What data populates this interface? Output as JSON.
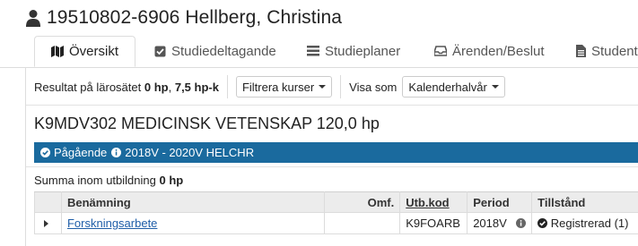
{
  "student": {
    "title": "19510802-6906 Hellberg, Christina",
    "icon": "person-icon"
  },
  "tabs": [
    {
      "label": "Översikt",
      "icon": "map-icon",
      "active": true
    },
    {
      "label": "Studiedeltagande",
      "icon": "checkbox-icon",
      "active": false
    },
    {
      "label": "Studieplaner",
      "icon": "list-icon",
      "active": false
    },
    {
      "label": "Ärenden/Beslut",
      "icon": "inbox-icon",
      "active": false
    },
    {
      "label": "Student",
      "icon": "file-icon",
      "active": false
    }
  ],
  "filter": {
    "result_prefix": "Resultat på lärosätet",
    "result_hp": "0 hp",
    "result_sep": ",",
    "result_hpk": "7,5 hp-k",
    "filter_button": "Filtrera kurser",
    "view_label": "Visa som",
    "view_select": "Kalenderhalvår"
  },
  "program": {
    "title": "K9MDV302 MEDICINSK VETENSKAP 120,0 hp",
    "status": "Pågående",
    "period": "2018V - 2020V HELCHR",
    "colors": {
      "status_bar": "#1a6a9e",
      "link": "#1f5ea8"
    }
  },
  "summary": {
    "label": "Summa inom utbildning",
    "value": "0 hp"
  },
  "table": {
    "headers": {
      "benamning": "Benämning",
      "omf": "Omf.",
      "utbkod": "Utb.kod",
      "period": "Period",
      "tillstand": "Tillstånd"
    },
    "rows": [
      {
        "benamning": "Forskningsarbete",
        "omf": "",
        "utbkod": "K9FOARB",
        "period": "2018V",
        "tillstand": "Registrerad (1)"
      }
    ]
  }
}
